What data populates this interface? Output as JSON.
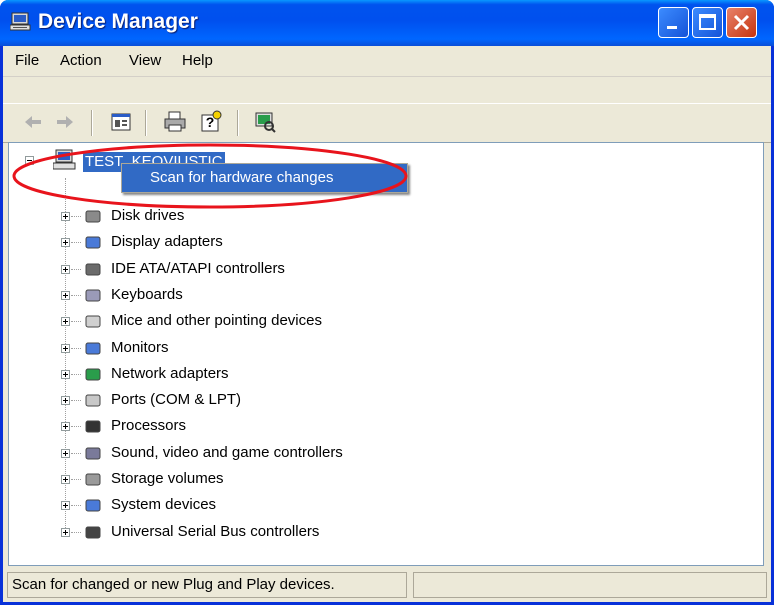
{
  "window": {
    "title": "Device Manager"
  },
  "menu": {
    "items": [
      "File",
      "Action",
      "View",
      "Help"
    ]
  },
  "toolbar": {
    "buttons": [
      "back-arrow-icon",
      "forward-arrow-icon",
      "properties-panel-icon",
      "print-icon",
      "help-icon",
      "scan-hardware-icon"
    ]
  },
  "tree": {
    "root": "TEST_KEOVIUSTIC",
    "categories": [
      {
        "label": "Disk drives",
        "icon": "disk-drive-icon"
      },
      {
        "label": "Display adapters",
        "icon": "display-adapter-icon"
      },
      {
        "label": "IDE ATA/ATAPI controllers",
        "icon": "ide-controller-icon"
      },
      {
        "label": "Keyboards",
        "icon": "keyboard-icon"
      },
      {
        "label": "Mice and other pointing devices",
        "icon": "mouse-icon"
      },
      {
        "label": "Monitors",
        "icon": "monitor-icon"
      },
      {
        "label": "Network adapters",
        "icon": "network-adapter-icon"
      },
      {
        "label": "Ports (COM & LPT)",
        "icon": "port-icon"
      },
      {
        "label": "Processors",
        "icon": "processor-icon"
      },
      {
        "label": "Sound, video and game controllers",
        "icon": "sound-icon"
      },
      {
        "label": "Storage volumes",
        "icon": "storage-volume-icon"
      },
      {
        "label": "System devices",
        "icon": "system-device-icon"
      },
      {
        "label": "Universal Serial Bus controllers",
        "icon": "usb-icon"
      }
    ]
  },
  "context_menu": {
    "item": "Scan for hardware changes"
  },
  "status": {
    "text": "Scan for changed or new Plug and Play devices."
  },
  "colors": {
    "titlebar": "#0053ee",
    "selection": "#316ac5",
    "highlight_ellipse": "#e8141c"
  }
}
